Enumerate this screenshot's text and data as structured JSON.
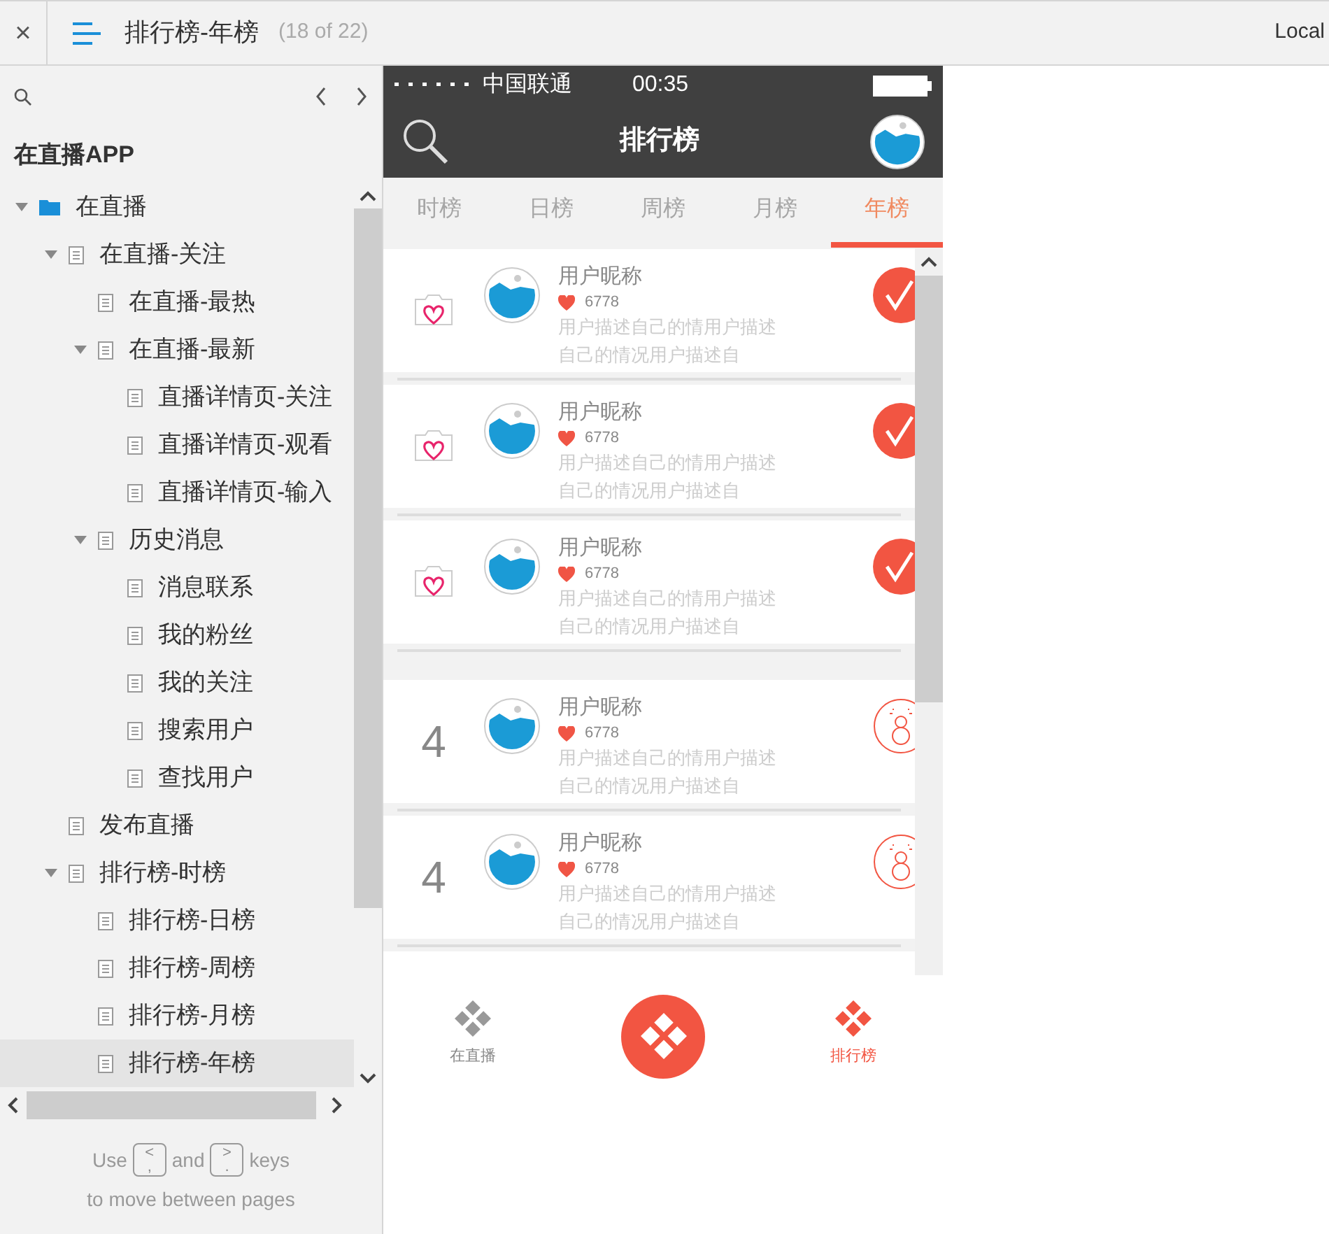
{
  "toolbar": {
    "close": "×",
    "title": "排行榜-年榜",
    "page_count": "(18 of 22)",
    "mode": "Local"
  },
  "sidebar": {
    "project": "在直播APP",
    "tree": [
      {
        "label": "在直播",
        "kind": "folder",
        "expanded": true,
        "selected": false,
        "children": [
          {
            "label": "在直播-关注",
            "kind": "page",
            "expanded": true,
            "selected": false,
            "children": [
              {
                "label": "在直播-最热",
                "kind": "page",
                "selected": false
              },
              {
                "label": "在直播-最新",
                "kind": "page",
                "expanded": true,
                "selected": false,
                "children": [
                  {
                    "label": "直播详情页-关注",
                    "kind": "page",
                    "selected": false
                  },
                  {
                    "label": "直播详情页-观看",
                    "kind": "page",
                    "selected": false
                  },
                  {
                    "label": "直播详情页-输入",
                    "kind": "page",
                    "selected": false
                  }
                ]
              },
              {
                "label": "历史消息",
                "kind": "page",
                "expanded": true,
                "selected": false,
                "children": [
                  {
                    "label": "消息联系",
                    "kind": "page",
                    "selected": false
                  },
                  {
                    "label": "我的粉丝",
                    "kind": "page",
                    "selected": false
                  },
                  {
                    "label": "我的关注",
                    "kind": "page",
                    "selected": false
                  },
                  {
                    "label": "搜索用户",
                    "kind": "page",
                    "selected": false
                  },
                  {
                    "label": "查找用户",
                    "kind": "page",
                    "selected": false
                  }
                ]
              }
            ]
          },
          {
            "label": "发布直播",
            "kind": "page",
            "selected": false
          },
          {
            "label": "排行榜-时榜",
            "kind": "page",
            "expanded": true,
            "selected": false,
            "children": [
              {
                "label": "排行榜-日榜",
                "kind": "page",
                "selected": false
              },
              {
                "label": "排行榜-周榜",
                "kind": "page",
                "selected": false
              },
              {
                "label": "排行榜-月榜",
                "kind": "page",
                "selected": false
              },
              {
                "label": "排行榜-年榜",
                "kind": "page",
                "selected": true
              }
            ]
          }
        ]
      }
    ],
    "hint": {
      "use": "Use",
      "key_prev": {
        "top": "<",
        "bottom": ","
      },
      "and": "and",
      "key_next": {
        "top": ">",
        "bottom": "."
      },
      "keys": "keys",
      "line2": "to move between pages"
    }
  },
  "phone": {
    "status_bar": {
      "carrier": "中国联通",
      "time": "00:35"
    },
    "header": {
      "title": "排行榜"
    },
    "tabs": [
      {
        "label": "时榜",
        "selected": false
      },
      {
        "label": "日榜",
        "selected": false
      },
      {
        "label": "周榜",
        "selected": false
      },
      {
        "label": "月榜",
        "selected": false
      },
      {
        "label": "年榜",
        "selected": true
      }
    ],
    "rows": [
      {
        "kind": "badge",
        "name": "用户昵称",
        "likes": "6778",
        "description_lines": [
          "用户描述自己的情用户描述",
          "自己的情况用户描述自"
        ],
        "action": {
          "kind": "check"
        }
      },
      {
        "kind": "badge",
        "name": "用户昵称",
        "likes": "6778",
        "description_lines": [
          "用户描述自己的情用户描述",
          "自己的情况用户描述自"
        ],
        "action": {
          "kind": "check"
        }
      },
      {
        "kind": "badge",
        "name": "用户昵称",
        "likes": "6778",
        "description_lines": [
          "用户描述自己的情用户描述",
          "自己的情况用户描述自"
        ],
        "action": {
          "kind": "check"
        }
      },
      {
        "kind": "rank",
        "rank": "4",
        "name": "用户昵称",
        "likes": "6778",
        "description_lines": [
          "用户描述自己的情用户描述",
          "自己的情况用户描述自"
        ],
        "action": {
          "kind": "gift"
        }
      },
      {
        "kind": "rank",
        "rank": "4",
        "name": "用户昵称",
        "likes": "6778",
        "description_lines": [
          "用户描述自己的情用户描述",
          "自己的情况用户描述自"
        ],
        "action": {
          "kind": "gift"
        }
      }
    ],
    "nav": [
      {
        "kind": "tab",
        "label": "在直播",
        "selected": false
      },
      {
        "kind": "fab"
      },
      {
        "kind": "tab",
        "label": "排行榜",
        "selected": true
      }
    ]
  }
}
